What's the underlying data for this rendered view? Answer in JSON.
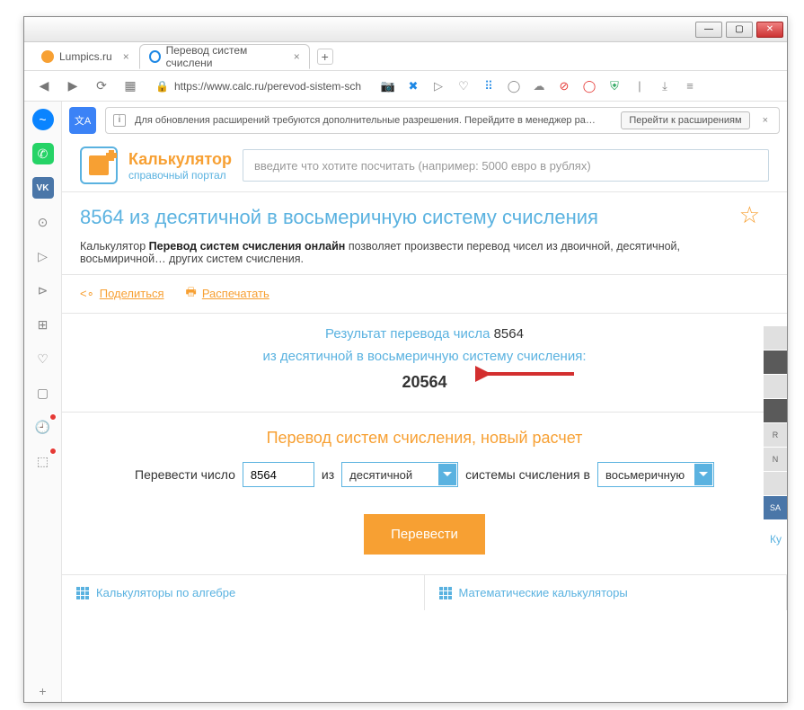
{
  "window": {
    "min": "—",
    "max": "▢",
    "close": "✕"
  },
  "tabs": [
    {
      "title": "Lumpics.ru"
    },
    {
      "title": "Перевод систем счислени"
    }
  ],
  "addr": {
    "url": "https://www.calc.ru/perevod-sistem-sch"
  },
  "notice": {
    "text": "Для обновления расширений требуются дополнительные разрешения. Перейдите в менеджер ра…",
    "button": "Перейти к расширениям"
  },
  "brand": {
    "title": "Калькулятор",
    "subtitle": "справочный портал"
  },
  "search": {
    "placeholder": "введите что хотите посчитать (например: 5000 евро в рублях)"
  },
  "heading": "8564 из десятичной в восьмеричную систему счисления",
  "desc_prefix": "Калькулятор ",
  "desc_bold": "Перевод систем счисления онлайн",
  "desc_suffix": " позволяет произвести перевод чисел из двоичной, десятичной, восьмиричной… других систем счисления.",
  "actions": {
    "share": "Поделиться",
    "print": "Распечатать"
  },
  "result": {
    "line1a": "Результат перевода числа ",
    "line1b": "8564",
    "line2": "из десятичной в восьмеричную систему счисления:",
    "value": "20564"
  },
  "form": {
    "title": "Перевод систем счисления, новый расчет",
    "label_number": "Перевести число",
    "input_value": "8564",
    "label_from": "из",
    "from_option": "десятичной",
    "label_mid": "системы счисления в",
    "to_option": "восьмеричную",
    "submit": "Перевести"
  },
  "cats": {
    "a": "Калькуляторы по алгебре",
    "b": "Математические калькуляторы"
  },
  "side": {
    "r": "R",
    "n": "N",
    "sa": "SA",
    "ku": "Ку"
  }
}
